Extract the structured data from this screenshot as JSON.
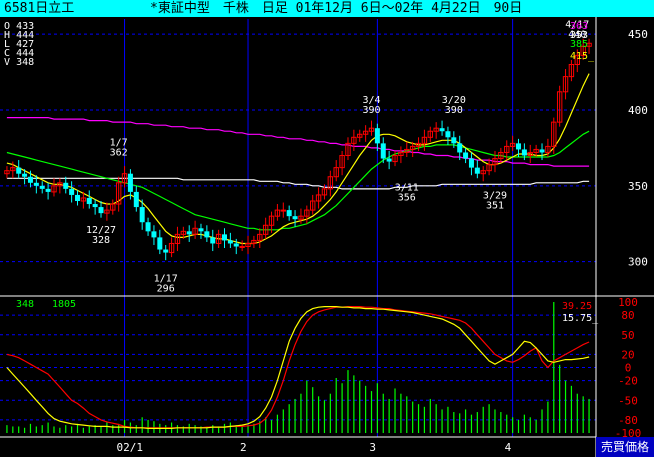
{
  "title": {
    "code": "6581日立工",
    "info": "*東証中型　千株　日足 01年12月 6日〜02年 4月22日　90日"
  },
  "colors": {
    "background": "#000000",
    "titlebar": "#00ffff",
    "grid": "#0000ff",
    "axis": "#ffffff",
    "candle_up": "#ff0000",
    "candle_down": "#00ffff",
    "ma_short": "#ffff00",
    "ma_mid": "#00ff00",
    "ma_long": "#ff00ff",
    "ma_vlong": "#ffffff",
    "osc_1": "#ff0000",
    "osc_2": "#ffff00",
    "volume": "#00ff00"
  },
  "ohlcv": {
    "O": {
      "label": "O",
      "value": "433"
    },
    "H": {
      "label": "H",
      "value": "444"
    },
    "L": {
      "label": "L",
      "value": "427"
    },
    "C": {
      "label": "C",
      "value": "444"
    },
    "V": {
      "label": "V",
      "value": "348"
    }
  },
  "ma_values": [
    {
      "value": "363",
      "color": "#ff00ff"
    },
    {
      "value": "353",
      "color": "#ffffff"
    },
    {
      "value": "385",
      "color": "#00ff00"
    },
    {
      "value": "415_",
      "color": "#ffff00"
    }
  ],
  "osc_header": {
    "vol": "348",
    "vol_ma": "1805"
  },
  "osc_values": [
    {
      "value": "39.25",
      "color": "#ff0000"
    },
    {
      "value": "15.75_",
      "color": "#ffffff"
    }
  ],
  "price_badge": "売買価格",
  "chart_data": {
    "type": "candlestick",
    "price_axis": {
      "ticks": [
        300,
        350,
        400,
        450
      ],
      "range": [
        280,
        460
      ]
    },
    "osc_axis": {
      "ticks": [
        100,
        80,
        50,
        20,
        0,
        -20,
        -50,
        -80,
        -100
      ],
      "range": [
        -100,
        100
      ]
    },
    "x_labels": [
      {
        "index": 20,
        "label": "02/1"
      },
      {
        "index": 41,
        "label": "2"
      },
      {
        "index": 63,
        "label": "3"
      },
      {
        "index": 86,
        "label": "4"
      }
    ],
    "annotations": [
      {
        "index": 19,
        "lines": [
          "1/7",
          "362"
        ],
        "value": 362,
        "pos": "above"
      },
      {
        "index": 16,
        "lines": [
          "12/27",
          "328"
        ],
        "value": 328,
        "pos": "below"
      },
      {
        "index": 27,
        "lines": [
          "1/17",
          "296"
        ],
        "value": 296,
        "pos": "below"
      },
      {
        "index": 62,
        "lines": [
          "3/4",
          "390"
        ],
        "value": 390,
        "pos": "above"
      },
      {
        "index": 68,
        "lines": [
          "3/11",
          "356"
        ],
        "value": 356,
        "pos": "below"
      },
      {
        "index": 76,
        "lines": [
          "3/20",
          "390"
        ],
        "value": 390,
        "pos": "above"
      },
      {
        "index": 83,
        "lines": [
          "3/29",
          "351"
        ],
        "value": 351,
        "pos": "below"
      },
      {
        "index": 97,
        "lines": [
          "4/17",
          "440"
        ],
        "value": 440,
        "pos": "above"
      }
    ],
    "close": [
      360,
      362,
      358,
      356,
      352,
      350,
      348,
      346,
      350,
      352,
      348,
      344,
      340,
      342,
      338,
      336,
      332,
      334,
      338,
      352,
      358,
      346,
      336,
      326,
      320,
      316,
      308,
      306,
      312,
      318,
      320,
      318,
      322,
      320,
      316,
      312,
      318,
      314,
      312,
      310,
      310,
      312,
      314,
      318,
      324,
      330,
      334,
      334,
      330,
      328,
      330,
      334,
      340,
      344,
      348,
      356,
      362,
      370,
      378,
      382,
      384,
      386,
      388,
      378,
      368,
      366,
      370,
      372,
      374,
      376,
      378,
      382,
      386,
      388,
      386,
      382,
      378,
      372,
      368,
      362,
      358,
      360,
      364,
      368,
      372,
      376,
      378,
      374,
      370,
      372,
      374,
      372,
      376,
      392,
      412,
      422,
      430,
      436,
      442,
      444
    ],
    "ma_short": [
      365,
      364,
      362,
      360,
      358,
      356,
      354,
      352,
      351,
      351,
      350,
      349,
      347,
      345,
      343,
      341,
      339,
      338,
      338,
      340,
      343,
      344,
      342,
      339,
      335,
      330,
      325,
      320,
      317,
      316,
      316,
      317,
      318,
      318,
      317,
      316,
      315,
      315,
      314,
      313,
      312,
      312,
      312,
      313,
      315,
      317,
      320,
      323,
      325,
      326,
      327,
      328,
      330,
      333,
      337,
      341,
      346,
      352,
      358,
      364,
      370,
      375,
      380,
      383,
      384,
      384,
      383,
      381,
      379,
      378,
      377,
      377,
      378,
      379,
      380,
      380,
      380,
      378,
      375,
      372,
      369,
      366,
      364,
      364,
      365,
      367,
      369,
      371,
      371,
      371,
      370,
      370,
      371,
      375,
      381,
      389,
      398,
      407,
      416,
      424
    ],
    "ma_mid": [
      372,
      371,
      370,
      369,
      368,
      367,
      366,
      365,
      364,
      363,
      362,
      361,
      360,
      359,
      358,
      357,
      356,
      355,
      354,
      353,
      352,
      351,
      350,
      349,
      347,
      345,
      343,
      341,
      339,
      337,
      335,
      333,
      331,
      330,
      329,
      328,
      327,
      326,
      325,
      324,
      323,
      322,
      322,
      321,
      321,
      321,
      321,
      322,
      322,
      323,
      324,
      325,
      327,
      329,
      331,
      334,
      337,
      341,
      345,
      349,
      353,
      357,
      361,
      364,
      367,
      369,
      371,
      372,
      373,
      374,
      375,
      376,
      376,
      377,
      377,
      377,
      377,
      376,
      375,
      374,
      373,
      372,
      371,
      370,
      370,
      369,
      369,
      369,
      369,
      369,
      369,
      369,
      369,
      370,
      372,
      375,
      378,
      381,
      384,
      386
    ],
    "ma_long": [
      395,
      395,
      395,
      395,
      395,
      395,
      395,
      395,
      394,
      394,
      394,
      394,
      394,
      394,
      393,
      393,
      393,
      393,
      392,
      392,
      392,
      392,
      391,
      391,
      391,
      390,
      390,
      390,
      389,
      389,
      389,
      388,
      388,
      388,
      387,
      387,
      387,
      386,
      386,
      385,
      385,
      384,
      384,
      384,
      383,
      383,
      382,
      382,
      381,
      381,
      381,
      380,
      380,
      379,
      379,
      378,
      378,
      377,
      377,
      376,
      376,
      376,
      375,
      375,
      374,
      374,
      373,
      373,
      373,
      372,
      372,
      371,
      371,
      370,
      370,
      370,
      369,
      369,
      368,
      368,
      367,
      367,
      367,
      366,
      366,
      366,
      365,
      365,
      365,
      364,
      364,
      364,
      364,
      363,
      363,
      363,
      363,
      363,
      363,
      363
    ],
    "ma_vlong": [
      355,
      355,
      355,
      355,
      355,
      355,
      355,
      355,
      355,
      355,
      355,
      355,
      355,
      355,
      355,
      355,
      355,
      355,
      355,
      355,
      355,
      355,
      355,
      355,
      355,
      355,
      355,
      355,
      355,
      355,
      354,
      354,
      354,
      354,
      354,
      354,
      354,
      354,
      354,
      354,
      354,
      354,
      354,
      353,
      353,
      353,
      353,
      352,
      352,
      351,
      351,
      351,
      350,
      350,
      349,
      349,
      349,
      348,
      348,
      348,
      348,
      348,
      348,
      348,
      348,
      348,
      349,
      349,
      349,
      350,
      350,
      350,
      350,
      350,
      351,
      351,
      351,
      351,
      351,
      351,
      351,
      351,
      351,
      351,
      351,
      351,
      351,
      351,
      351,
      351,
      352,
      352,
      352,
      352,
      352,
      352,
      352,
      352,
      353,
      353
    ],
    "osc_red": [
      20,
      18,
      15,
      10,
      5,
      0,
      -5,
      -10,
      -20,
      -30,
      -40,
      -50,
      -55,
      -62,
      -70,
      -75,
      -80,
      -83,
      -85,
      -87,
      -90,
      -91,
      -92,
      -92,
      -92,
      -92,
      -92,
      -92,
      -92,
      -92,
      -92,
      -92,
      -92,
      -92,
      -91,
      -91,
      -91,
      -91,
      -90,
      -90,
      -90,
      -89,
      -88,
      -85,
      -78,
      -65,
      -45,
      -20,
      10,
      35,
      55,
      70,
      80,
      85,
      88,
      90,
      92,
      92,
      93,
      93,
      93,
      92,
      92,
      91,
      90,
      90,
      88,
      87,
      86,
      85,
      84,
      83,
      82,
      80,
      78,
      76,
      74,
      72,
      68,
      60,
      50,
      40,
      30,
      20,
      15,
      10,
      8,
      12,
      18,
      25,
      30,
      10,
      0,
      10,
      15,
      20,
      25,
      30,
      35,
      39
    ],
    "osc_yellow": [
      0,
      -10,
      -20,
      -30,
      -40,
      -50,
      -60,
      -70,
      -78,
      -82,
      -84,
      -86,
      -87,
      -88,
      -89,
      -90,
      -90,
      -90,
      -91,
      -91,
      -91,
      -92,
      -92,
      -92,
      -93,
      -93,
      -93,
      -93,
      -93,
      -92,
      -92,
      -92,
      -92,
      -92,
      -92,
      -91,
      -91,
      -91,
      -90,
      -89,
      -88,
      -86,
      -82,
      -75,
      -62,
      -45,
      -20,
      10,
      40,
      60,
      75,
      85,
      90,
      92,
      93,
      93,
      93,
      92,
      92,
      91,
      91,
      90,
      90,
      89,
      89,
      88,
      87,
      86,
      85,
      84,
      82,
      80,
      78,
      76,
      74,
      70,
      66,
      60,
      50,
      40,
      30,
      20,
      10,
      5,
      10,
      15,
      20,
      30,
      40,
      38,
      30,
      20,
      10,
      8,
      10,
      12,
      12,
      13,
      14,
      16
    ],
    "volume": [
      6,
      5,
      5,
      4,
      7,
      5,
      6,
      8,
      5,
      4,
      6,
      5,
      7,
      4,
      5,
      6,
      5,
      8,
      6,
      7,
      10,
      8,
      6,
      12,
      10,
      9,
      7,
      6,
      8,
      6,
      5,
      7,
      6,
      5,
      4,
      6,
      5,
      7,
      8,
      6,
      5,
      6,
      7,
      9,
      12,
      10,
      14,
      18,
      22,
      26,
      30,
      40,
      35,
      28,
      25,
      30,
      42,
      38,
      48,
      44,
      40,
      36,
      32,
      38,
      30,
      26,
      34,
      30,
      28,
      24,
      22,
      20,
      26,
      22,
      18,
      20,
      16,
      15,
      18,
      14,
      16,
      20,
      22,
      18,
      16,
      14,
      12,
      10,
      14,
      12,
      10,
      18,
      24,
      100,
      52,
      40,
      36,
      30,
      28,
      26
    ]
  }
}
